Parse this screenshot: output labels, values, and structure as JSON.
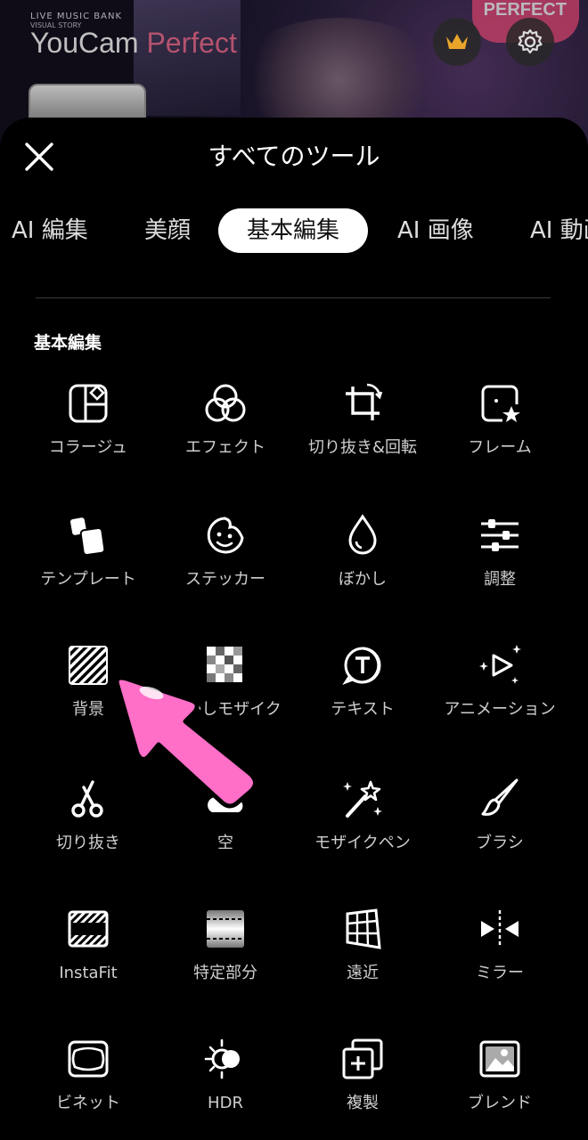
{
  "app": {
    "brand_prefix": "YouCam",
    "brand_suffix": "Perfect",
    "brand_live": "LIVE MUSIC BANK",
    "brand_sub": "VISUAL STORY",
    "badge": "PERFECT"
  },
  "sheet": {
    "title": "すべてのツール",
    "tabs": [
      "AI 編集",
      "美顔",
      "基本編集",
      "AI 画像",
      "AI 動画"
    ],
    "active_tab": "基本編集",
    "section": "基本編集"
  },
  "tools": [
    {
      "label": "コラージュ",
      "icon": "collage-icon"
    },
    {
      "label": "エフェクト",
      "icon": "effect-icon"
    },
    {
      "label": "切り抜き&回転",
      "icon": "crop-rotate-icon"
    },
    {
      "label": "フレーム",
      "icon": "frame-icon"
    },
    {
      "label": "テンプレート",
      "icon": "template-icon"
    },
    {
      "label": "ステッカー",
      "icon": "sticker-icon"
    },
    {
      "label": "ぼかし",
      "icon": "blur-drop-icon"
    },
    {
      "label": "調整",
      "icon": "adjust-sliders-icon"
    },
    {
      "label": "背景",
      "icon": "background-icon"
    },
    {
      "label": "ぼかしモザイク",
      "icon": "mosaic-icon"
    },
    {
      "label": "テキスト",
      "icon": "text-icon"
    },
    {
      "label": "アニメーション",
      "icon": "animation-icon"
    },
    {
      "label": "切り抜き",
      "icon": "scissors-icon"
    },
    {
      "label": "空",
      "icon": "sky-icon"
    },
    {
      "label": "モザイクペン",
      "icon": "magic-wand-icon"
    },
    {
      "label": "ブラシ",
      "icon": "brush-icon"
    },
    {
      "label": "InstaFit",
      "icon": "instafit-icon"
    },
    {
      "label": "特定部分",
      "icon": "partial-icon"
    },
    {
      "label": "遠近",
      "icon": "perspective-icon"
    },
    {
      "label": "ミラー",
      "icon": "mirror-icon"
    },
    {
      "label": "ビネット",
      "icon": "vignette-icon"
    },
    {
      "label": "HDR",
      "icon": "hdr-icon"
    },
    {
      "label": "複製",
      "icon": "duplicate-icon"
    },
    {
      "label": "ブレンド",
      "icon": "blend-icon"
    }
  ],
  "colors": {
    "accent_pink": "#ff6ec7",
    "active_tab_bg": "#ffffff"
  }
}
